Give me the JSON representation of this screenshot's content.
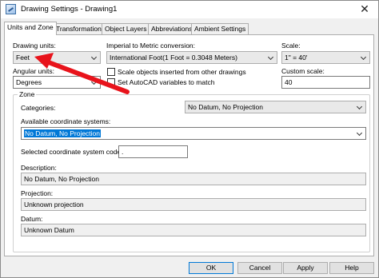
{
  "window": {
    "title": "Drawing Settings - Drawing1",
    "close_glyph": "✕",
    "icon": "drawing-settings-icon"
  },
  "tabs": [
    {
      "label": "Units and Zone",
      "active": true
    },
    {
      "label": "Transformation",
      "active": false
    },
    {
      "label": "Object Layers",
      "active": false
    },
    {
      "label": "Abbreviations",
      "active": false
    },
    {
      "label": "Ambient Settings",
      "active": false
    }
  ],
  "units": {
    "drawing_units_label": "Drawing units:",
    "drawing_units_value": "Feet",
    "angular_units_label": "Angular units:",
    "angular_units_value": "Degrees",
    "imperial_label": "Imperial to Metric conversion:",
    "imperial_value": "International Foot(1 Foot = 0.3048 Meters)",
    "scale_objects_label": "Scale objects inserted from other drawings",
    "set_autocad_label": "Set AutoCAD variables to match",
    "scale_label": "Scale:",
    "scale_value": "1\" = 40'",
    "custom_scale_label": "Custom scale:",
    "custom_scale_value": "40"
  },
  "zone": {
    "title": "Zone",
    "categories_label": "Categories:",
    "categories_value": "No Datum, No Projection",
    "available_label": "Available coordinate systems:",
    "available_value": "No Datum, No Projection",
    "selected_code_label": "Selected coordinate system code:",
    "selected_code_value": ".",
    "description_label": "Description:",
    "description_value": "No Datum, No Projection",
    "projection_label": "Projection:",
    "projection_value": "Unknown projection",
    "datum_label": "Datum:",
    "datum_value": "Unknown Datum"
  },
  "buttons": {
    "ok": "OK",
    "cancel": "Cancel",
    "apply": "Apply",
    "help": "Help"
  },
  "colors": {
    "annotation_arrow": "#e8131b",
    "selection": "#0078d7"
  }
}
